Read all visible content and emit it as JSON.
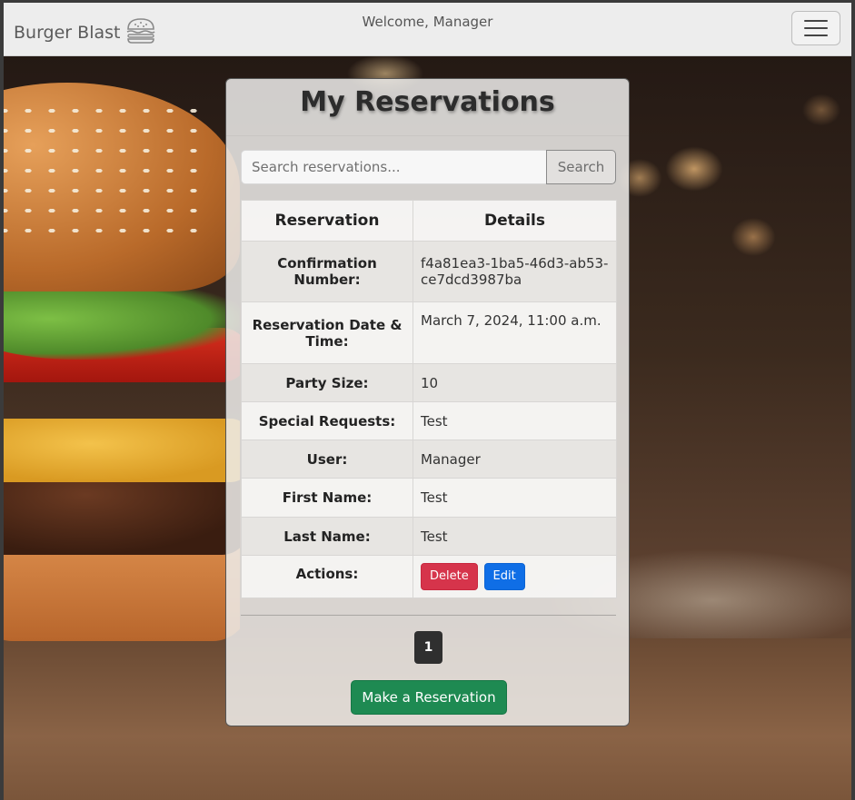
{
  "navbar": {
    "brand": "Burger Blast",
    "brand_icon": "burger-icon",
    "welcome": "Welcome, Manager",
    "menu_icon": "hamburger-menu-icon"
  },
  "card": {
    "title": "My Reservations",
    "search": {
      "placeholder": "Search reservations...",
      "value": "",
      "button_label": "Search"
    },
    "table": {
      "headers": [
        "Reservation",
        "Details"
      ],
      "rows": [
        {
          "label": "Confirmation Number:",
          "value": "f4a81ea3-1ba5-46d3-ab53-ce7dcd3987ba"
        },
        {
          "label": "Reservation Date & Time:",
          "value": "March 7, 2024, 11:00 a.m."
        },
        {
          "label": "Party Size:",
          "value": "10"
        },
        {
          "label": "Special Requests:",
          "value": "Test"
        },
        {
          "label": "User:",
          "value": "Manager"
        },
        {
          "label": "First Name:",
          "value": "Test"
        },
        {
          "label": "Last Name:",
          "value": "Test"
        },
        {
          "label": "Actions:",
          "value": ""
        }
      ],
      "actions": {
        "delete_label": "Delete",
        "edit_label": "Edit"
      }
    },
    "pagination": {
      "current_page": "1"
    },
    "make_reservation_label": "Make a Reservation"
  },
  "colors": {
    "delete": "#d6344b",
    "edit": "#0f6ee6",
    "make_reservation": "#1e8a52",
    "page_active": "#2f2f2f"
  }
}
